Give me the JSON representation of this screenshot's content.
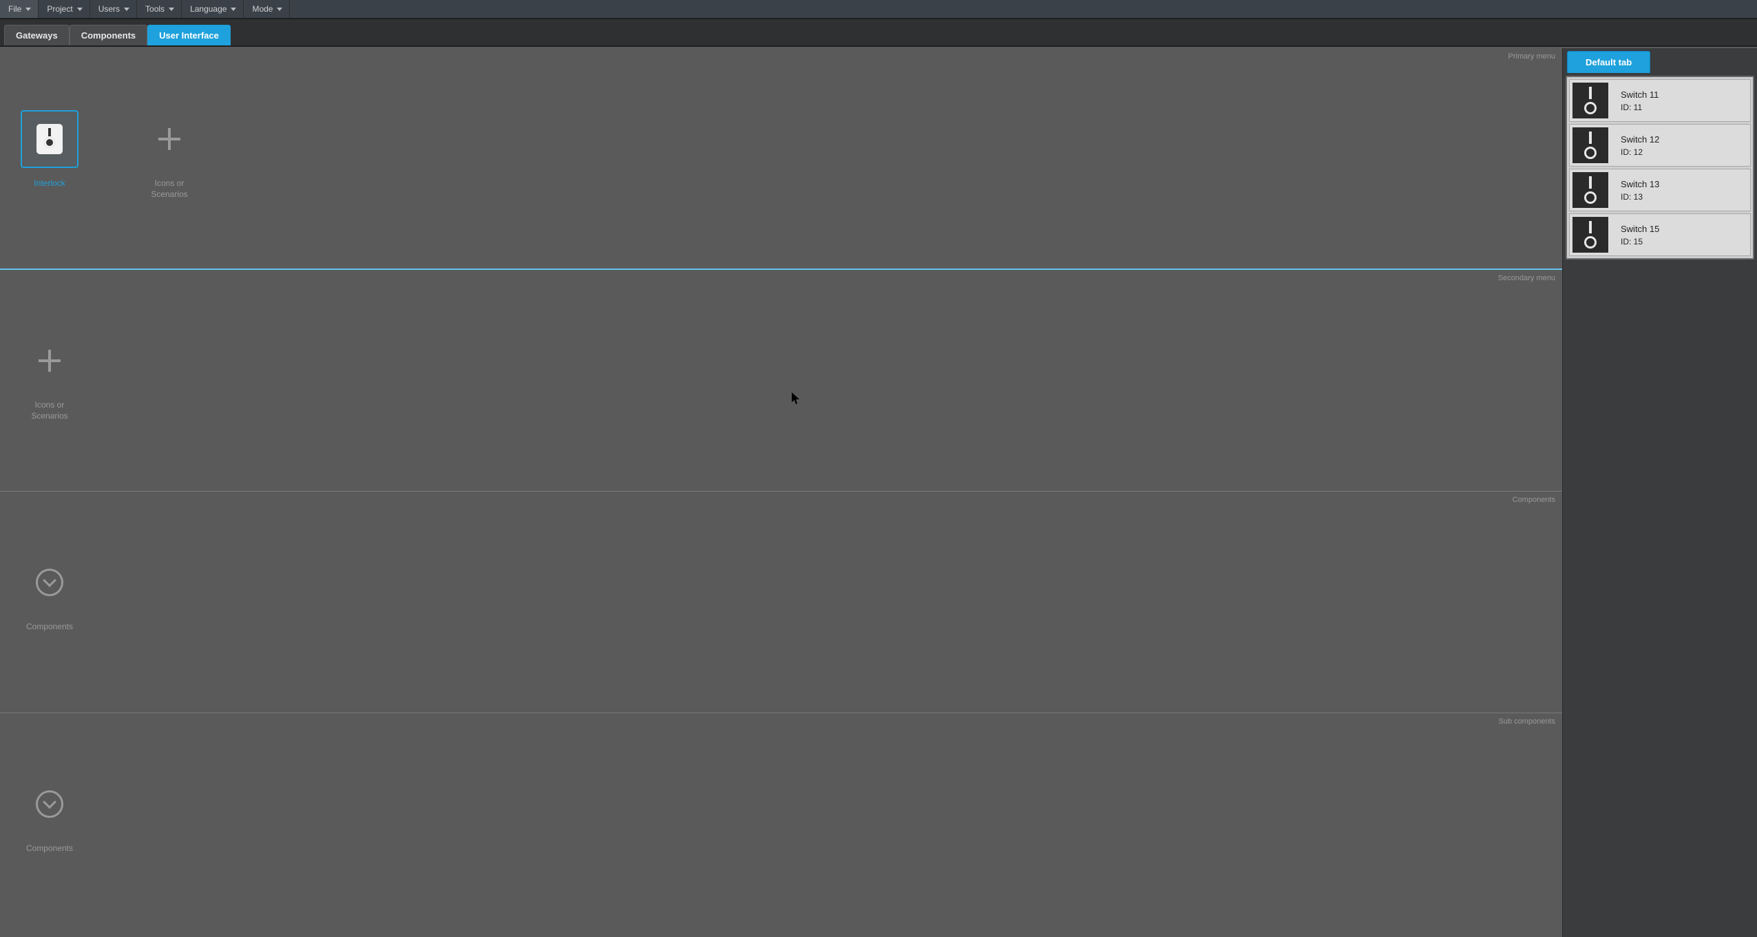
{
  "menubar": [
    {
      "label": "File"
    },
    {
      "label": "Project"
    },
    {
      "label": "Users"
    },
    {
      "label": "Tools"
    },
    {
      "label": "Language"
    },
    {
      "label": "Mode"
    }
  ],
  "tabs": [
    {
      "label": "Gateways",
      "active": false
    },
    {
      "label": "Components",
      "active": false
    },
    {
      "label": "User Interface",
      "active": true
    }
  ],
  "sections": {
    "primary_label": "Primary menu",
    "secondary_label": "Secondary menu",
    "components_label": "Components",
    "subcomponents_label": "Sub components"
  },
  "primary_tiles": {
    "interlock_label": "Interlock",
    "add_label": "Icons or\nScenarios"
  },
  "secondary_tiles": {
    "add_label": "Icons or\nScenarios"
  },
  "component_tiles": {
    "label": "Components"
  },
  "subcomponent_tiles": {
    "label": "Components"
  },
  "side": {
    "tab_label": "Default tab",
    "items": [
      {
        "name": "Switch 11",
        "id": "ID: 11"
      },
      {
        "name": "Switch 12",
        "id": "ID: 12"
      },
      {
        "name": "Switch 13",
        "id": "ID: 13"
      },
      {
        "name": "Switch 15",
        "id": "ID: 15"
      }
    ]
  }
}
